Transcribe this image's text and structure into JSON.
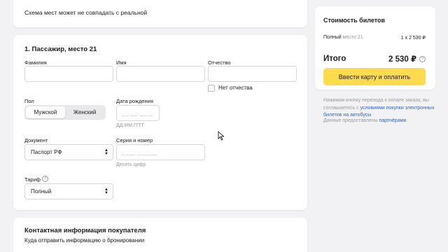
{
  "top_note": "Схема мест может не совпадать с реальной",
  "passenger": {
    "title": "1. Пассажир, место 21",
    "last_name_label": "Фамилия",
    "first_name_label": "Имя",
    "middle_name_label": "Отчество",
    "no_middle_name_label": "Нет отчества",
    "gender_label": "Пол",
    "gender_options": [
      "Мужской",
      "Женский"
    ],
    "gender_selected": "Мужской",
    "birth_date_label": "Дата рождения",
    "birth_date_mask": "__.__.____",
    "birth_date_hint": "ДД.ММ.ГГГГ",
    "document_label": "Документ",
    "document_value": "Паспорт РФ",
    "series_label": "Серия и номер",
    "series_mask": "____ ______",
    "series_hint": "Десять цифр",
    "tariff_label": "Тариф",
    "tariff_value": "Полный"
  },
  "contact": {
    "title": "Контактная информация покупателя",
    "subtitle": "Куда отправить информацию о бронировании"
  },
  "summary": {
    "title": "Стоимость билетов",
    "row_type": "Полный",
    "row_seat": "место 21",
    "row_price": "1 x 2 530 ₽",
    "total_label": "Итого",
    "total_value": "2 530 ₽",
    "pay_button": "Ввести карту и оплатить"
  },
  "legal": {
    "text_before": "Нажимая кнопку перехода к оплате заказа, вы соглашаетесь с ",
    "link": "условиями покупки электронных билетов на автобусы",
    "provided_before": "Данные предоставлены ",
    "provided_link": "партнёрами",
    "provided_after": "."
  },
  "colors": {
    "accent_yellow": "#ffdb4d",
    "link_blue": "#3366bb",
    "background": "#f2f2f4"
  }
}
